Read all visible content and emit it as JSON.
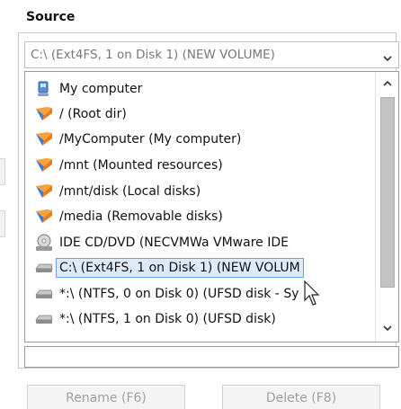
{
  "source": {
    "title": "Source",
    "combo_value": "C:\\  (Ext4FS, 1 on Disk 1) (NEW VOLUME)",
    "list_items": [
      {
        "icon": "computer-icon",
        "label": "My computer"
      },
      {
        "icon": "folder-linux-icon",
        "label": "/ (Root dir)"
      },
      {
        "icon": "folder-linux-icon",
        "label": "/MyComputer (My computer)"
      },
      {
        "icon": "folder-linux-icon",
        "label": "/mnt (Mounted resources)"
      },
      {
        "icon": "folder-linux-icon",
        "label": "/mnt/disk (Local disks)"
      },
      {
        "icon": "folder-linux-icon",
        "label": "/media (Removable disks)"
      },
      {
        "icon": "cd-drive-icon",
        "label": "IDE CD/DVD (NECVMWa VMware IDE"
      },
      {
        "icon": "hard-drive-icon",
        "label": "C:\\  (Ext4FS, 1 on Disk 1) (NEW VOLUM"
      },
      {
        "icon": "hard-drive-icon",
        "label": "*:\\  (NTFS, 0 on Disk 0) (UFSD disk - Sy"
      },
      {
        "icon": "hard-drive-icon",
        "label": "*:\\  (NTFS, 1 on Disk 0) (UFSD disk)"
      }
    ],
    "selected_index": 7
  },
  "buttons": {
    "rename_label": "Rename (F6)",
    "delete_label": "Delete (F8)"
  },
  "colors": {
    "selection_bg": "#dceafb",
    "selection_border": "#6ea0dc",
    "folder_orange": "#f07a1a",
    "folder_blue": "#3a7bd5",
    "disabled_text": "#a0a0a0"
  }
}
